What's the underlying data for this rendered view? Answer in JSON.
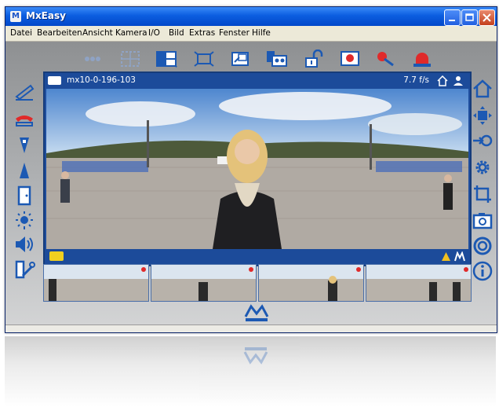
{
  "window": {
    "title": "MxEasy",
    "app_icon": "mobotix-app-icon",
    "controls": [
      "minimize-icon",
      "maximize-icon",
      "close-icon"
    ]
  },
  "menu": [
    "Datei",
    "Bearbeiten",
    "Ansicht",
    "Kamera",
    "I/O",
    "Bild",
    "Extras",
    "Fenster",
    "Hilfe"
  ],
  "toolbar": {
    "icons": [
      "page-dots-icon",
      "layout-grid-icon",
      "layout-split-icon",
      "fullscreen-icon",
      "window-restore-icon",
      "camera-group-icon",
      "unlock-icon",
      "record-icon",
      "alarm-pin-icon",
      "siren-icon"
    ]
  },
  "left_sidebar": {
    "icons": [
      "handset-up-icon",
      "handset-down-icon",
      "arrow-down-icon",
      "arrow-up-icon",
      "door-icon",
      "light-icon",
      "speaker-icon",
      "tools-icon"
    ]
  },
  "right_sidebar": {
    "icons": [
      "home-icon",
      "arrows-expand-icon",
      "login-icon",
      "settings-gear-icon",
      "crop-icon",
      "snapshot-icon",
      "lifebuoy-icon",
      "info-icon"
    ]
  },
  "camera_panel": {
    "name": "mx10-0-196-103",
    "fps": "7.7 f/s",
    "status_icons": [
      "home-status-icon",
      "user-status-icon"
    ],
    "footer_icons": [
      "recording-badge-icon",
      "warning-icon",
      "mobotix-small-icon"
    ]
  },
  "thumbnails": {
    "count": 4
  },
  "logo": "MOBOTIX",
  "colors": {
    "title_bar": "#0c5ee0",
    "panel_blue": "#1c4b9a",
    "record_red": "#e02a2a",
    "icon_blue": "#1c59b3"
  }
}
